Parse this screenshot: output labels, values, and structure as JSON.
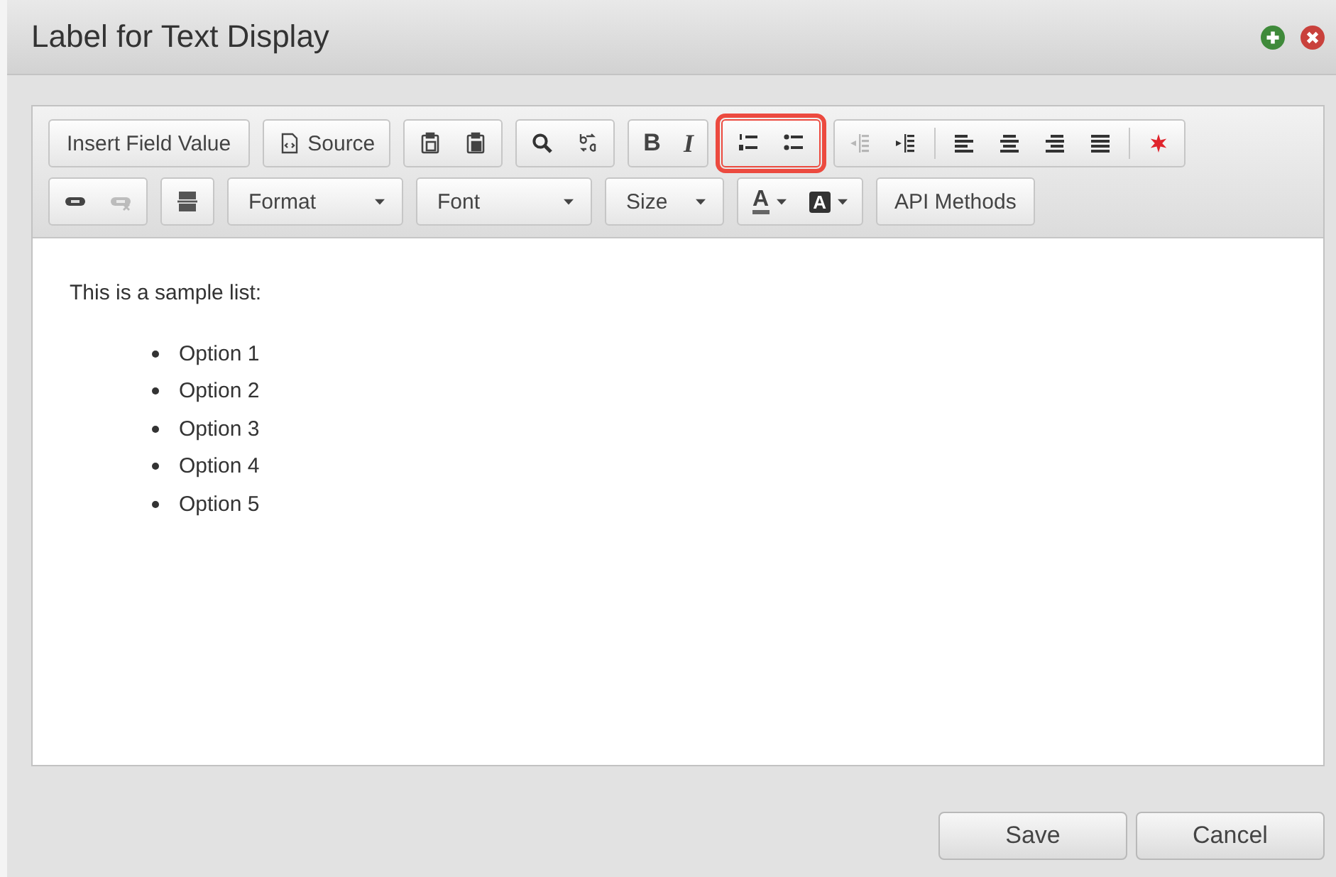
{
  "window": {
    "title": "Label for Text Display"
  },
  "toolbar": {
    "rows": [
      {
        "groups": [
          {
            "highlighted": false,
            "items": [
              {
                "kind": "text",
                "label": "Insert Field Value",
                "disabled": false
              }
            ]
          },
          {
            "highlighted": false,
            "items": [
              {
                "kind": "source",
                "label": "Source",
                "disabled": false
              }
            ]
          },
          {
            "highlighted": false,
            "items": [
              {
                "kind": "paste",
                "disabled": false
              },
              {
                "kind": "paste-text",
                "disabled": false
              }
            ]
          },
          {
            "highlighted": false,
            "items": [
              {
                "kind": "find",
                "disabled": false
              },
              {
                "kind": "replace",
                "disabled": false
              }
            ]
          },
          {
            "highlighted": false,
            "items": [
              {
                "kind": "bold",
                "label": "B",
                "disabled": false
              },
              {
                "kind": "italic",
                "label": "I",
                "disabled": false
              }
            ]
          },
          {
            "highlighted": true,
            "items": [
              {
                "kind": "ordered-list",
                "disabled": false
              },
              {
                "kind": "bullet-list",
                "disabled": false
              }
            ]
          },
          {
            "highlighted": false,
            "items": [
              {
                "kind": "outdent",
                "disabled": true
              },
              {
                "kind": "indent",
                "disabled": false
              },
              {
                "kind": "separator"
              },
              {
                "kind": "align-left",
                "disabled": false
              },
              {
                "kind": "align-center",
                "disabled": false
              },
              {
                "kind": "align-right",
                "disabled": false
              },
              {
                "kind": "justify",
                "disabled": false
              },
              {
                "kind": "separator"
              },
              {
                "kind": "special",
                "disabled": false
              }
            ]
          }
        ]
      },
      {
        "groups": [
          {
            "highlighted": false,
            "items": [
              {
                "kind": "link",
                "disabled": false
              },
              {
                "kind": "unlink",
                "disabled": true
              }
            ]
          },
          {
            "highlighted": false,
            "items": [
              {
                "kind": "hr",
                "disabled": false
              }
            ]
          },
          {
            "highlighted": false,
            "items": [
              {
                "kind": "combo",
                "label": "Format",
                "disabled": false
              }
            ]
          },
          {
            "highlighted": false,
            "items": [
              {
                "kind": "combo",
                "label": "Font",
                "disabled": false
              }
            ]
          },
          {
            "highlighted": false,
            "items": [
              {
                "kind": "combo",
                "label": "Size",
                "disabled": false
              }
            ]
          },
          {
            "highlighted": false,
            "items": [
              {
                "kind": "text-color",
                "label": "A",
                "disabled": false
              },
              {
                "kind": "bg-color",
                "label": "A",
                "disabled": false
              }
            ]
          },
          {
            "highlighted": false,
            "items": [
              {
                "kind": "text",
                "label": "API Methods",
                "disabled": false
              }
            ]
          }
        ]
      }
    ]
  },
  "content": {
    "paragraph": "This is a sample list:",
    "list": [
      "Option 1",
      "Option 2",
      "Option 3",
      "Option 4",
      "Option 5"
    ]
  },
  "buttons": [
    "Save",
    "Cancel"
  ]
}
